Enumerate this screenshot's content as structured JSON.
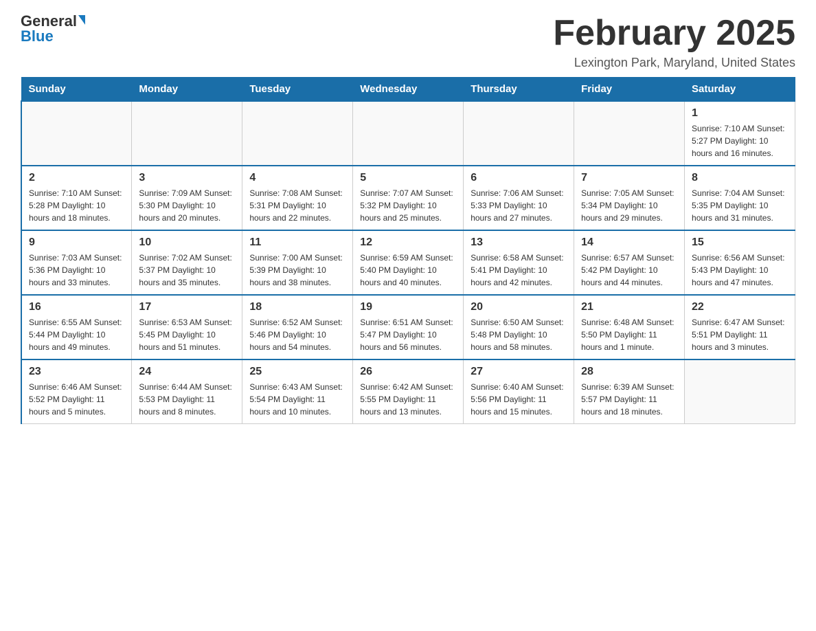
{
  "logo": {
    "general": "General",
    "blue": "Blue"
  },
  "title": "February 2025",
  "subtitle": "Lexington Park, Maryland, United States",
  "days_of_week": [
    "Sunday",
    "Monday",
    "Tuesday",
    "Wednesday",
    "Thursday",
    "Friday",
    "Saturday"
  ],
  "weeks": [
    [
      {
        "day": "",
        "info": ""
      },
      {
        "day": "",
        "info": ""
      },
      {
        "day": "",
        "info": ""
      },
      {
        "day": "",
        "info": ""
      },
      {
        "day": "",
        "info": ""
      },
      {
        "day": "",
        "info": ""
      },
      {
        "day": "1",
        "info": "Sunrise: 7:10 AM\nSunset: 5:27 PM\nDaylight: 10 hours and 16 minutes."
      }
    ],
    [
      {
        "day": "2",
        "info": "Sunrise: 7:10 AM\nSunset: 5:28 PM\nDaylight: 10 hours and 18 minutes."
      },
      {
        "day": "3",
        "info": "Sunrise: 7:09 AM\nSunset: 5:30 PM\nDaylight: 10 hours and 20 minutes."
      },
      {
        "day": "4",
        "info": "Sunrise: 7:08 AM\nSunset: 5:31 PM\nDaylight: 10 hours and 22 minutes."
      },
      {
        "day": "5",
        "info": "Sunrise: 7:07 AM\nSunset: 5:32 PM\nDaylight: 10 hours and 25 minutes."
      },
      {
        "day": "6",
        "info": "Sunrise: 7:06 AM\nSunset: 5:33 PM\nDaylight: 10 hours and 27 minutes."
      },
      {
        "day": "7",
        "info": "Sunrise: 7:05 AM\nSunset: 5:34 PM\nDaylight: 10 hours and 29 minutes."
      },
      {
        "day": "8",
        "info": "Sunrise: 7:04 AM\nSunset: 5:35 PM\nDaylight: 10 hours and 31 minutes."
      }
    ],
    [
      {
        "day": "9",
        "info": "Sunrise: 7:03 AM\nSunset: 5:36 PM\nDaylight: 10 hours and 33 minutes."
      },
      {
        "day": "10",
        "info": "Sunrise: 7:02 AM\nSunset: 5:37 PM\nDaylight: 10 hours and 35 minutes."
      },
      {
        "day": "11",
        "info": "Sunrise: 7:00 AM\nSunset: 5:39 PM\nDaylight: 10 hours and 38 minutes."
      },
      {
        "day": "12",
        "info": "Sunrise: 6:59 AM\nSunset: 5:40 PM\nDaylight: 10 hours and 40 minutes."
      },
      {
        "day": "13",
        "info": "Sunrise: 6:58 AM\nSunset: 5:41 PM\nDaylight: 10 hours and 42 minutes."
      },
      {
        "day": "14",
        "info": "Sunrise: 6:57 AM\nSunset: 5:42 PM\nDaylight: 10 hours and 44 minutes."
      },
      {
        "day": "15",
        "info": "Sunrise: 6:56 AM\nSunset: 5:43 PM\nDaylight: 10 hours and 47 minutes."
      }
    ],
    [
      {
        "day": "16",
        "info": "Sunrise: 6:55 AM\nSunset: 5:44 PM\nDaylight: 10 hours and 49 minutes."
      },
      {
        "day": "17",
        "info": "Sunrise: 6:53 AM\nSunset: 5:45 PM\nDaylight: 10 hours and 51 minutes."
      },
      {
        "day": "18",
        "info": "Sunrise: 6:52 AM\nSunset: 5:46 PM\nDaylight: 10 hours and 54 minutes."
      },
      {
        "day": "19",
        "info": "Sunrise: 6:51 AM\nSunset: 5:47 PM\nDaylight: 10 hours and 56 minutes."
      },
      {
        "day": "20",
        "info": "Sunrise: 6:50 AM\nSunset: 5:48 PM\nDaylight: 10 hours and 58 minutes."
      },
      {
        "day": "21",
        "info": "Sunrise: 6:48 AM\nSunset: 5:50 PM\nDaylight: 11 hours and 1 minute."
      },
      {
        "day": "22",
        "info": "Sunrise: 6:47 AM\nSunset: 5:51 PM\nDaylight: 11 hours and 3 minutes."
      }
    ],
    [
      {
        "day": "23",
        "info": "Sunrise: 6:46 AM\nSunset: 5:52 PM\nDaylight: 11 hours and 5 minutes."
      },
      {
        "day": "24",
        "info": "Sunrise: 6:44 AM\nSunset: 5:53 PM\nDaylight: 11 hours and 8 minutes."
      },
      {
        "day": "25",
        "info": "Sunrise: 6:43 AM\nSunset: 5:54 PM\nDaylight: 11 hours and 10 minutes."
      },
      {
        "day": "26",
        "info": "Sunrise: 6:42 AM\nSunset: 5:55 PM\nDaylight: 11 hours and 13 minutes."
      },
      {
        "day": "27",
        "info": "Sunrise: 6:40 AM\nSunset: 5:56 PM\nDaylight: 11 hours and 15 minutes."
      },
      {
        "day": "28",
        "info": "Sunrise: 6:39 AM\nSunset: 5:57 PM\nDaylight: 11 hours and 18 minutes."
      },
      {
        "day": "",
        "info": ""
      }
    ]
  ]
}
